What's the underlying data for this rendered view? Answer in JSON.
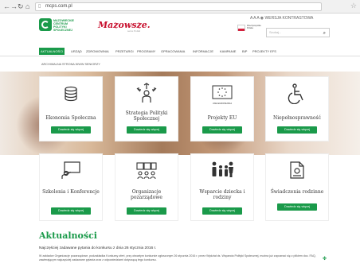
{
  "browser": {
    "url": "mcps.com.pl"
  },
  "header": {
    "logo_text": [
      "MAZOWIECKIE",
      "CENTRUM",
      "POLITYKI",
      "SPOŁECZNEJ"
    ],
    "mazowsze": "Mazowsze.",
    "mazowsze_sub": "serce Polski",
    "a11y_label": "A A A  ◉ WERSJA KONTRASTOWA",
    "flag_text": "Rzeczpospolita Polska",
    "search_placeholder": "Szukaj..."
  },
  "nav": {
    "items": [
      "AKTUALNOŚCI",
      "URZĄD",
      "ZDROWOWNIA",
      "PRZETARGI",
      "PROGRAMY",
      "OPRACOWANIA",
      "INFORMACJE",
      "KAMPANIE",
      "BIP",
      "PROJEKTY EFS"
    ],
    "archive": "ARCHIWALNA STRONA WWW   SENIORZY"
  },
  "tiles": [
    {
      "label": "Ekonomia Społeczna",
      "button": "Dowiedz się więcej",
      "icon": "coins-icon"
    },
    {
      "label": "Strategia Polityki Społecznej",
      "button": "Dowiedz się więcej",
      "icon": "strategy-icon"
    },
    {
      "label": "Projekty EU",
      "button": "Dowiedz się więcej",
      "icon": "eu-flag-icon",
      "sublabel": "UNIA EUROPEJSKA"
    },
    {
      "label": "Niepełnosprawność",
      "button": "Dowiedz się więcej",
      "icon": "wheelchair-icon"
    },
    {
      "label": "Szkolenia i Konferencje",
      "button": "Dowiedz się więcej",
      "icon": "presentation-icon"
    },
    {
      "label": "Organizacje pozarządowe",
      "button": "Dowiedz się więcej",
      "icon": "organizations-icon"
    },
    {
      "label": "Wsparcie dziecka i rodziny",
      "button": "Dowiedz się więcej",
      "icon": "family-icon"
    },
    {
      "label": "Świadczenia rodzinne",
      "button": "Dowiedz się więcej",
      "icon": "document-icon"
    }
  ],
  "news": {
    "section_title": "Aktualności",
    "headline": "Najczęściej zadawane pytania do konkursu z dnia 26 stycznia 2016 r.",
    "snippet": "W zakładce Organizacje pozarządowe, podzakładka Konkursy ofert, przy otwartym konkursie ogłoszonym 26 stycznia 2016 r. przez Wydział ds. Wsparcia Polityki Społecznej, można już zapoznać się z plikiem doc. FAQ, zawierającym najczęściej zadawane pytania oraz z odpowiedziami dotyczącą tego konkursu."
  },
  "colors": {
    "brand_green": "#1a9a4a",
    "mazowsze_red": "#c8102e"
  }
}
